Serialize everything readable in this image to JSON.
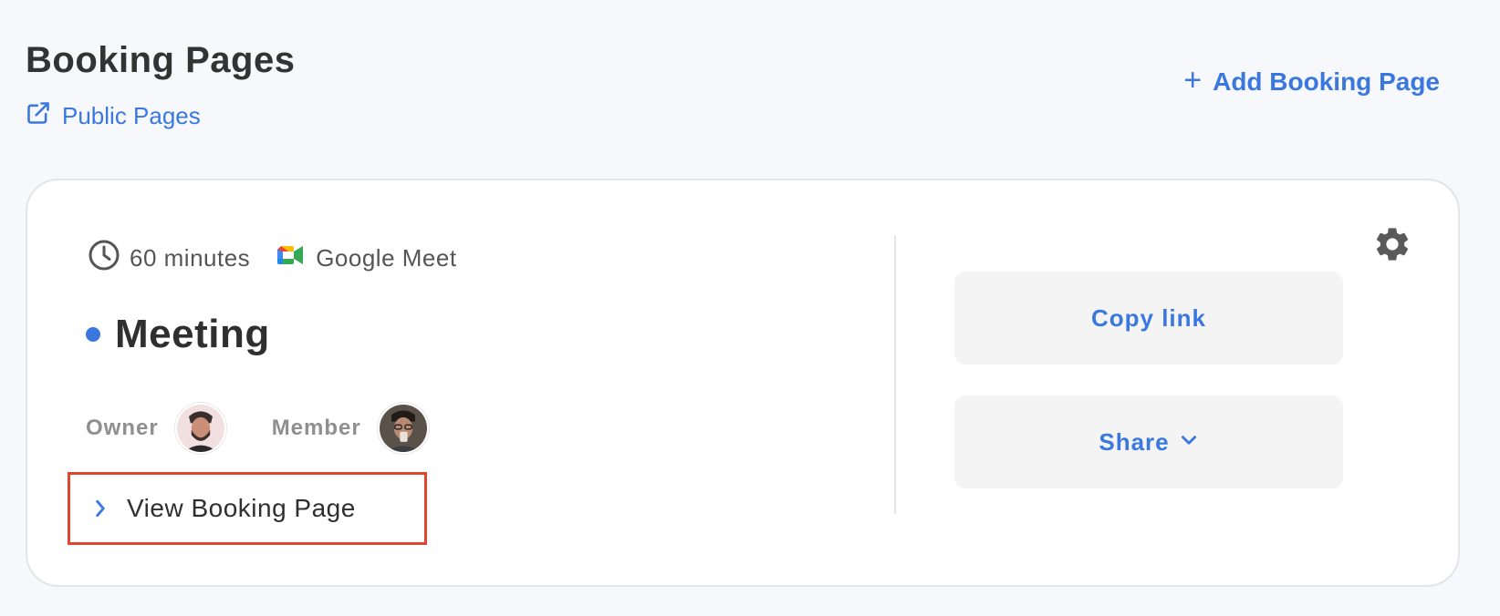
{
  "header": {
    "title": "Booking Pages",
    "public_pages_label": "Public Pages",
    "add_label": "Add Booking Page"
  },
  "card": {
    "duration": "60 minutes",
    "location": "Google Meet",
    "title": "Meeting",
    "owner_label": "Owner",
    "member_label": "Member",
    "view_label": "View Booking Page",
    "copy_label": "Copy link",
    "share_label": "Share"
  },
  "icons": {
    "public_pages": "external-link-icon",
    "add": "plus-icon",
    "duration": "clock-icon",
    "location": "google-meet-icon",
    "view": "chevron-right-icon",
    "settings": "gear-icon",
    "share": "chevron-down-icon"
  },
  "colors": {
    "accent": "#3a78e0",
    "highlight_border": "#e2452f",
    "background": "#f7f8fb",
    "button_bg": "#f4f4f4"
  }
}
